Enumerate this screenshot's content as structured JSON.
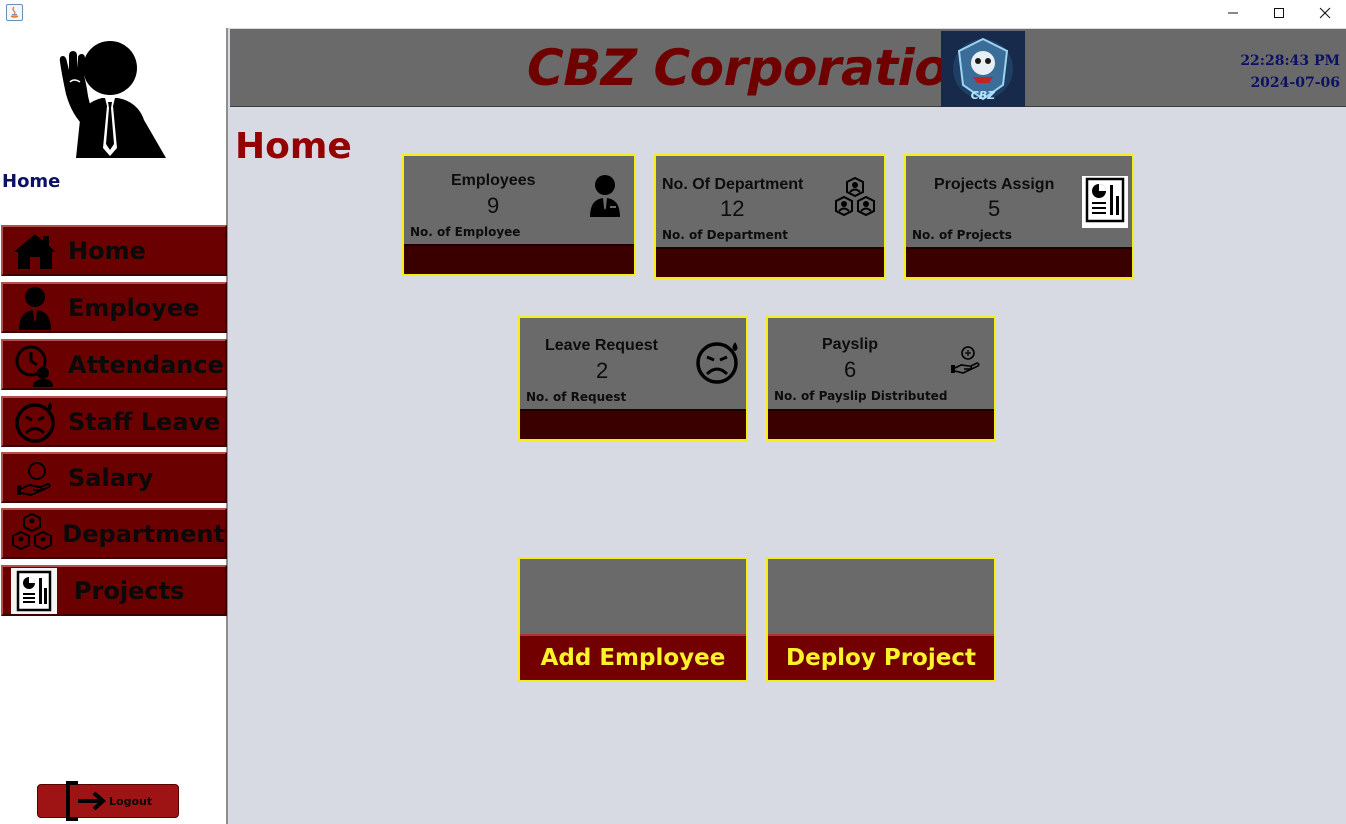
{
  "window": {
    "app_icon": "java-icon",
    "controls": [
      "minimize-icon",
      "maximize-icon",
      "close-icon"
    ]
  },
  "sidebar": {
    "avatar_icon": "businessman-waving-icon",
    "current_page": "Home",
    "items": [
      {
        "label": "Home",
        "icon": "house-icon"
      },
      {
        "label": "Employee",
        "icon": "employee-icon"
      },
      {
        "label": "Attendance",
        "icon": "attendance-clock-icon"
      },
      {
        "label": "Staff Leave",
        "icon": "sad-face-icon"
      },
      {
        "label": "Salary",
        "icon": "salary-hand-icon"
      },
      {
        "label": "Department",
        "icon": "department-group-icon"
      },
      {
        "label": "Projects",
        "icon": "project-report-icon"
      }
    ],
    "logout_label": "Logout"
  },
  "header": {
    "company": "CBZ Corporation",
    "logo_text": "CBZ",
    "time": "22:28:43 PM",
    "date": "2024-07-06"
  },
  "page_title": "Home",
  "cards": [
    {
      "title": "Employees",
      "value": "9",
      "subtitle": "No. of Employee",
      "icon": "employee-icon"
    },
    {
      "title": "No. Of Department",
      "value": "12",
      "subtitle": "No. of Department",
      "icon": "department-group-icon"
    },
    {
      "title": "Projects Assign",
      "value": "5",
      "subtitle": "No. of Projects",
      "icon": "project-report-icon"
    },
    {
      "title": "Leave Request",
      "value": "2",
      "subtitle": "No. of Request",
      "icon": "sad-face-icon"
    },
    {
      "title": "Payslip",
      "value": "6",
      "subtitle": "No. of Payslip Distributed",
      "icon": "salary-hand-icon"
    }
  ],
  "actions": [
    {
      "label": "Add Employee"
    },
    {
      "label": "Deploy Project"
    }
  ],
  "colors": {
    "accent_red": "#6b0000",
    "title_red": "#950000",
    "card_border": "#f4ee17",
    "action_text": "#fbf32a",
    "clock_blue": "#0b1163",
    "panel_grey": "#6a6a6a",
    "background": "#d7d9e3"
  }
}
